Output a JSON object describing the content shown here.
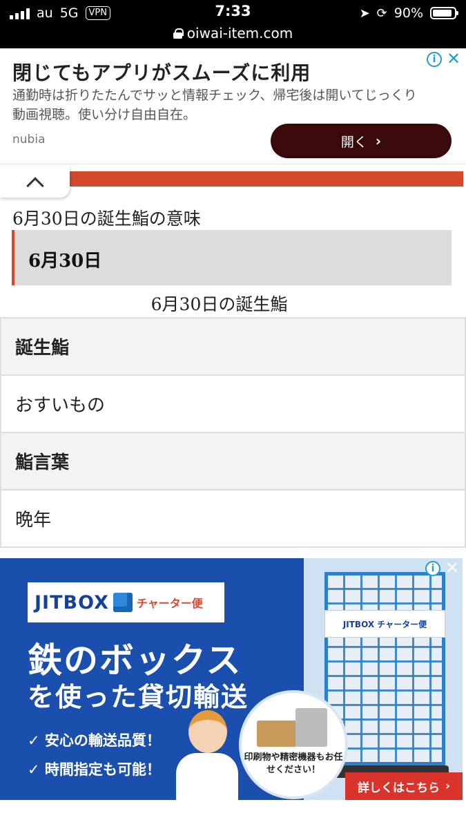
{
  "status_bar": {
    "carrier": "au",
    "network": "5G",
    "vpn": "VPN",
    "time": "7:33",
    "battery_text": "90%",
    "battery_level": 0.9,
    "url": "oiwai-item.com"
  },
  "top_ad": {
    "title": "閉じてもアプリがスムーズに利用",
    "description": "通勤時は折りたたんでサッと情報チェック、帰宅後は開いてじっくり動画視聴。使い分け自由自在。",
    "brand": "nubia",
    "open_button": "開く",
    "info_glyph": "i",
    "close_glyph": "✕"
  },
  "article": {
    "heading": "6月30日の誕生鮨の意味",
    "date_box": "6月30日",
    "table_caption": "6月30日の誕生鮨",
    "rows": [
      {
        "label": "誕生鮨",
        "value": "おすいもの"
      },
      {
        "label": "鮨言葉",
        "value": "晩年"
      }
    ]
  },
  "bottom_ad": {
    "logo_text": "JITBOX",
    "logo_sub": "チャーター便",
    "headline_line1": "鉄のボックス",
    "headline_line2": "を使った貸切輸送",
    "bullets": [
      "✓ 安心の輸送品質！",
      "✓ 時間指定も可能！"
    ],
    "bubble_note": "印刷物や精密機器もお任せください！",
    "cage_label": "JITBOX チャーター便",
    "cta": "詳しくはこちら",
    "info_glyph": "i",
    "close_glyph": "✕"
  },
  "colors": {
    "accent_red": "#d24a2b",
    "ad_blue": "#1a4fae",
    "open_button_bg": "#3a0a0a",
    "adchoices_blue": "#1a9fd8"
  }
}
